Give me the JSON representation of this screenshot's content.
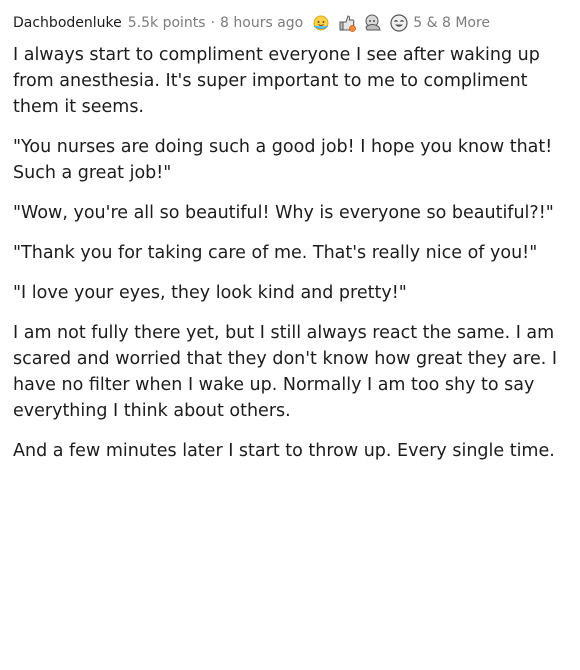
{
  "comment": {
    "username": "Dachbodenluke",
    "points": "5.5k points",
    "separator": "·",
    "time": "8 hours ago",
    "awards": [
      {
        "icon": "wholesome-award-icon",
        "color": "#f5b52a"
      },
      {
        "icon": "rocket-like-award-icon",
        "color": "#7a7a7a"
      },
      {
        "icon": "hugz-award-icon",
        "color": "#7a7a7a"
      },
      {
        "icon": "laughing-face-award-icon",
        "color": "#7a7a7a"
      }
    ],
    "award_count": "5 & 8 More",
    "paragraphs": [
      "I always start to compliment everyone I see after waking up from anesthesia. It's super important to me to compliment them it seems.",
      "\"You nurses are doing such a good job! I hope you know that! Such a great job!\"",
      "\"Wow, you're all so beautiful! Why is everyone so beautiful?!\"",
      "\"Thank you for taking care of me. That's really nice of you!\"",
      "\"I love your eyes, they look kind and pretty!\"",
      "I am not fully there yet, but I still always react the same. I am scared and worried that they don't know how great they are. I have no filter when I wake up. Normally I am too shy to say everything I think about others.",
      "And a few minutes later I start to throw up. Every single time."
    ]
  }
}
